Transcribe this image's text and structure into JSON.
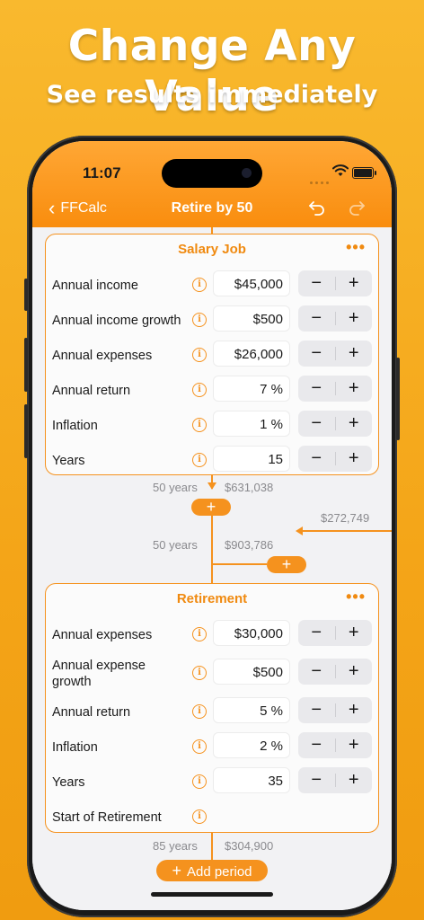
{
  "promo": {
    "headline": "Change Any Value",
    "subheadline": "See results immediately"
  },
  "status_bar": {
    "time": "11:07"
  },
  "nav": {
    "back_label": "FFCalc",
    "title": "Retire by 50"
  },
  "colors": {
    "accent": "#f5921e",
    "bar_top": "#ffa735",
    "bar_bottom": "#f98d0e",
    "background": "#f4a518"
  },
  "periods": [
    {
      "title": "Salary Job",
      "more": "•••",
      "rows": [
        {
          "label": "Annual income",
          "value": "$45,000",
          "stepper": true
        },
        {
          "label": "Annual income growth",
          "value": "$500",
          "stepper": true
        },
        {
          "label": "Annual expenses",
          "value": "$26,000",
          "stepper": true
        },
        {
          "label": "Annual return",
          "value": "7 %",
          "stepper": true
        },
        {
          "label": "Inflation",
          "value": "1 %",
          "stepper": true
        },
        {
          "label": "Years",
          "value": "15",
          "stepper": true
        }
      ]
    },
    {
      "title": "Retirement",
      "more": "•••",
      "rows": [
        {
          "label": "Annual expenses",
          "value": "$30,000",
          "stepper": true
        },
        {
          "label": "Annual expense growth",
          "value": "$500",
          "stepper": true
        },
        {
          "label": "Annual return",
          "value": "5 %",
          "stepper": true
        },
        {
          "label": "Inflation",
          "value": "2 %",
          "stepper": true
        },
        {
          "label": "Years",
          "value": "35",
          "stepper": true
        },
        {
          "label": "Start of Retirement",
          "value": "",
          "stepper": false
        }
      ]
    }
  ],
  "flow": {
    "after_job": {
      "age": "50 years",
      "amount": "$631,038"
    },
    "incoming": {
      "amount": "$272,749"
    },
    "combined": {
      "age": "50 years",
      "amount": "$903,786"
    },
    "after_retirement": {
      "age": "85 years",
      "amount": "$304,900"
    }
  },
  "stepper": {
    "minus": "−",
    "plus": "+"
  },
  "add_pill": "+",
  "add_period_label": "Add period",
  "info_glyph": "i"
}
